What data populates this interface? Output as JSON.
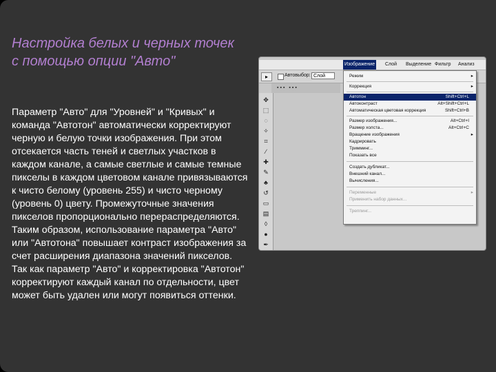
{
  "slide": {
    "title": "Настройка белых и черных точек с помощью опции \"Авто\"",
    "body": "Параметр \"Авто\" для \"Уровней\" и \"Кривых\" и команда \"Автотон\" автоматически корректируют черную и белую точки изображения. При этом отсекается часть теней и светлых участков в каждом канале, а самые светлые и самые темные пикселы в каждом цветовом канале привязываются к чисто белому (уровень 255) и чисто черному (уровень 0) цвету. Промежуточные значения пикселов пропорционально перераспределяются. Таким образом, использование параметра \"Авто\" или \"Автотона\" повышает контраст изображения за счет расширения диапазона значений пикселов. Так как параметр \"Авто\" и корректировка \"Автотон\" корректируют каждый канал по отдельности, цвет может быть удален или могут появиться оттенки."
  },
  "screenshot": {
    "menubar": [
      "Изображение",
      "Слой",
      "Выделение",
      "Фильтр",
      "Анализ"
    ],
    "options_bar": {
      "checkbox_label": "Автовыбор:",
      "select_value": "Слой"
    },
    "dropdown": {
      "items": [
        {
          "label": "Режим",
          "submenu": true
        },
        {
          "label": "Коррекция",
          "submenu": true
        },
        {
          "label": "Автотон",
          "shortcut": "Shift+Ctrl+L",
          "highlighted": true
        },
        {
          "label": "Автоконтраст",
          "shortcut": "Alt+Shift+Ctrl+L"
        },
        {
          "label": "Автоматическая цветовая коррекция",
          "shortcut": "Shift+Ctrl+B"
        },
        {
          "label": "Размер изображения...",
          "shortcut": "Alt+Ctrl+I"
        },
        {
          "label": "Размер холста...",
          "shortcut": "Alt+Ctrl+C"
        },
        {
          "label": "Вращение изображения",
          "submenu": true
        },
        {
          "label": "Кадрировать"
        },
        {
          "label": "Тримминг..."
        },
        {
          "label": "Показать все"
        },
        {
          "label": "Создать дубликат..."
        },
        {
          "label": "Внешний канал..."
        },
        {
          "label": "Вычисления..."
        },
        {
          "label": "Переменные",
          "submenu": true,
          "disabled": true
        },
        {
          "label": "Применить набор данных...",
          "disabled": true
        },
        {
          "label": "Треппинг...",
          "disabled": true
        }
      ]
    }
  },
  "colors": {
    "slide_bg": "#333333",
    "title": "#b27fd0",
    "body_text": "#ffffff",
    "menu_highlight": "#0a246a"
  }
}
